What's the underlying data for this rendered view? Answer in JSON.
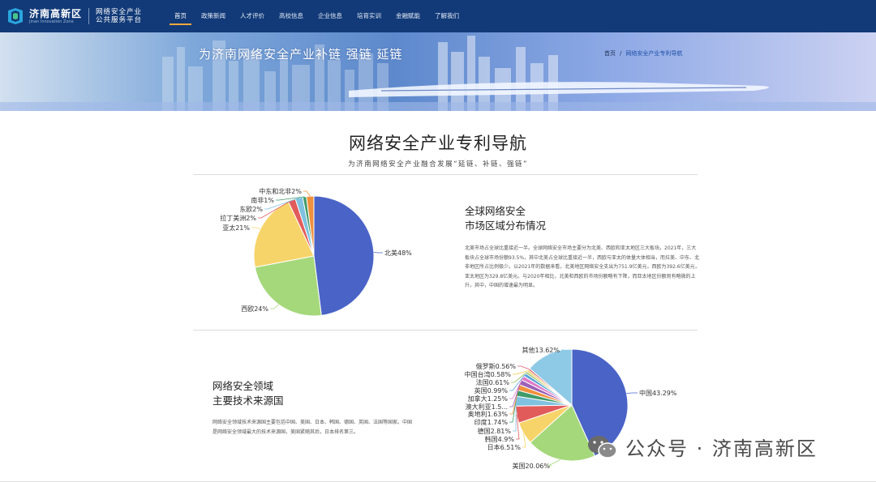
{
  "header": {
    "logo_main": "济南高新区",
    "logo_sub": "Jinan Innovation Zone",
    "platform_line1": "网络安全产业",
    "platform_line2": "公共服务平台",
    "nav": [
      {
        "label": "首页",
        "active": true
      },
      {
        "label": "政策新闻",
        "active": false
      },
      {
        "label": "人才评价",
        "active": false
      },
      {
        "label": "高校信息",
        "active": false
      },
      {
        "label": "企业信息",
        "active": false
      },
      {
        "label": "培育实训",
        "active": false
      },
      {
        "label": "金融赋能",
        "active": false
      },
      {
        "label": "了解我们",
        "active": false
      }
    ]
  },
  "banner": {
    "slogan": "为济南网络安全产业补链 强链 延链",
    "breadcrumb_home": "首页",
    "breadcrumb_sep": "/",
    "breadcrumb_current": "网络安全产业专利导航"
  },
  "page": {
    "title": "网络安全产业专利导航",
    "subtitle": "为济南网络安全产业融合发展“延链、补链、强链”"
  },
  "section1": {
    "title_line1": "全球网络安全",
    "title_line2": "市场区域分布情况",
    "body": "北美市场占全球比重接近一半。全球网络安全市场主要分为北美、西欧和亚太地区三大板块。2021年，三大板块占全球市场份额93.5%，其中北美占全球比重接近一半，西欧与亚太的体量大体相当，而拉美、中东、北非地区所占比例极少。以2021年的数据来看，北美地区网络安全支出为751.9亿美元，西欧为392.6亿美元，亚太地区为329.8亿美元。与2020年相比，北美和西欧的市场份额略有下降，而亚太地区份额则有略微的上升，其中，中国的增速最为明显。"
  },
  "section2": {
    "title_line1": "网络安全领域",
    "title_line2": "主要技术来源国",
    "body": "网络安全领域技术来源国主要包括中国、美国、日本、韩国、德国、英国、法国等国家。中国是网络安全领域最大的技术来源国，美国紧随其后，日本排名第三。"
  },
  "watermark": {
    "text": "公众号 · 济南高新区"
  },
  "colors": {
    "header_bg": "#123a78",
    "nav_active_underline": "#f3a93a",
    "breadcrumb_current": "#1d4fa6"
  },
  "chart_data": [
    {
      "type": "pie",
      "title": "",
      "slices": [
        {
          "label": "北美48%",
          "value": 48,
          "color": "#4a63c6"
        },
        {
          "label": "西欧24%",
          "value": 24,
          "color": "#a5d87b"
        },
        {
          "label": "亚太21%",
          "value": 21,
          "color": "#f6d46a"
        },
        {
          "label": "拉丁美洲2%",
          "value": 2,
          "color": "#e25b5b"
        },
        {
          "label": "东欧2%",
          "value": 2,
          "color": "#7fc1df"
        },
        {
          "label": "南非1%",
          "value": 1,
          "color": "#3f9b6a"
        },
        {
          "label": "中东和北非2%",
          "value": 2,
          "color": "#f0913e"
        }
      ]
    },
    {
      "type": "pie",
      "title": "",
      "slices": [
        {
          "label": "中国43.29%",
          "value": 43.29,
          "color": "#4a63c6"
        },
        {
          "label": "美国20.06%",
          "value": 20.06,
          "color": "#a5d87b"
        },
        {
          "label": "日本6.51%",
          "value": 6.51,
          "color": "#f6d46a"
        },
        {
          "label": "韩国4.9%",
          "value": 4.9,
          "color": "#e25b5b"
        },
        {
          "label": "德国2.81%",
          "value": 2.81,
          "color": "#7fc1df"
        },
        {
          "label": "印度1.74%",
          "value": 1.74,
          "color": "#3f9b6a"
        },
        {
          "label": "奥地利1.63%",
          "value": 1.63,
          "color": "#f0913e"
        },
        {
          "label": "澳大利亚1.5...",
          "value": 1.5,
          "color": "#9b61b8"
        },
        {
          "label": "加拿大1.25%",
          "value": 1.25,
          "color": "#e07bc9"
        },
        {
          "label": "英国0.99%",
          "value": 0.99,
          "color": "#5aa5d8"
        },
        {
          "label": "法国0.61%",
          "value": 0.61,
          "color": "#94c25e"
        },
        {
          "label": "中国台湾0.58%",
          "value": 0.58,
          "color": "#f4c243"
        },
        {
          "label": "俄罗斯0.56%",
          "value": 0.56,
          "color": "#d95f6b"
        },
        {
          "label": "其他13.62%",
          "value": 13.62,
          "color": "#8ecae6"
        }
      ]
    }
  ]
}
